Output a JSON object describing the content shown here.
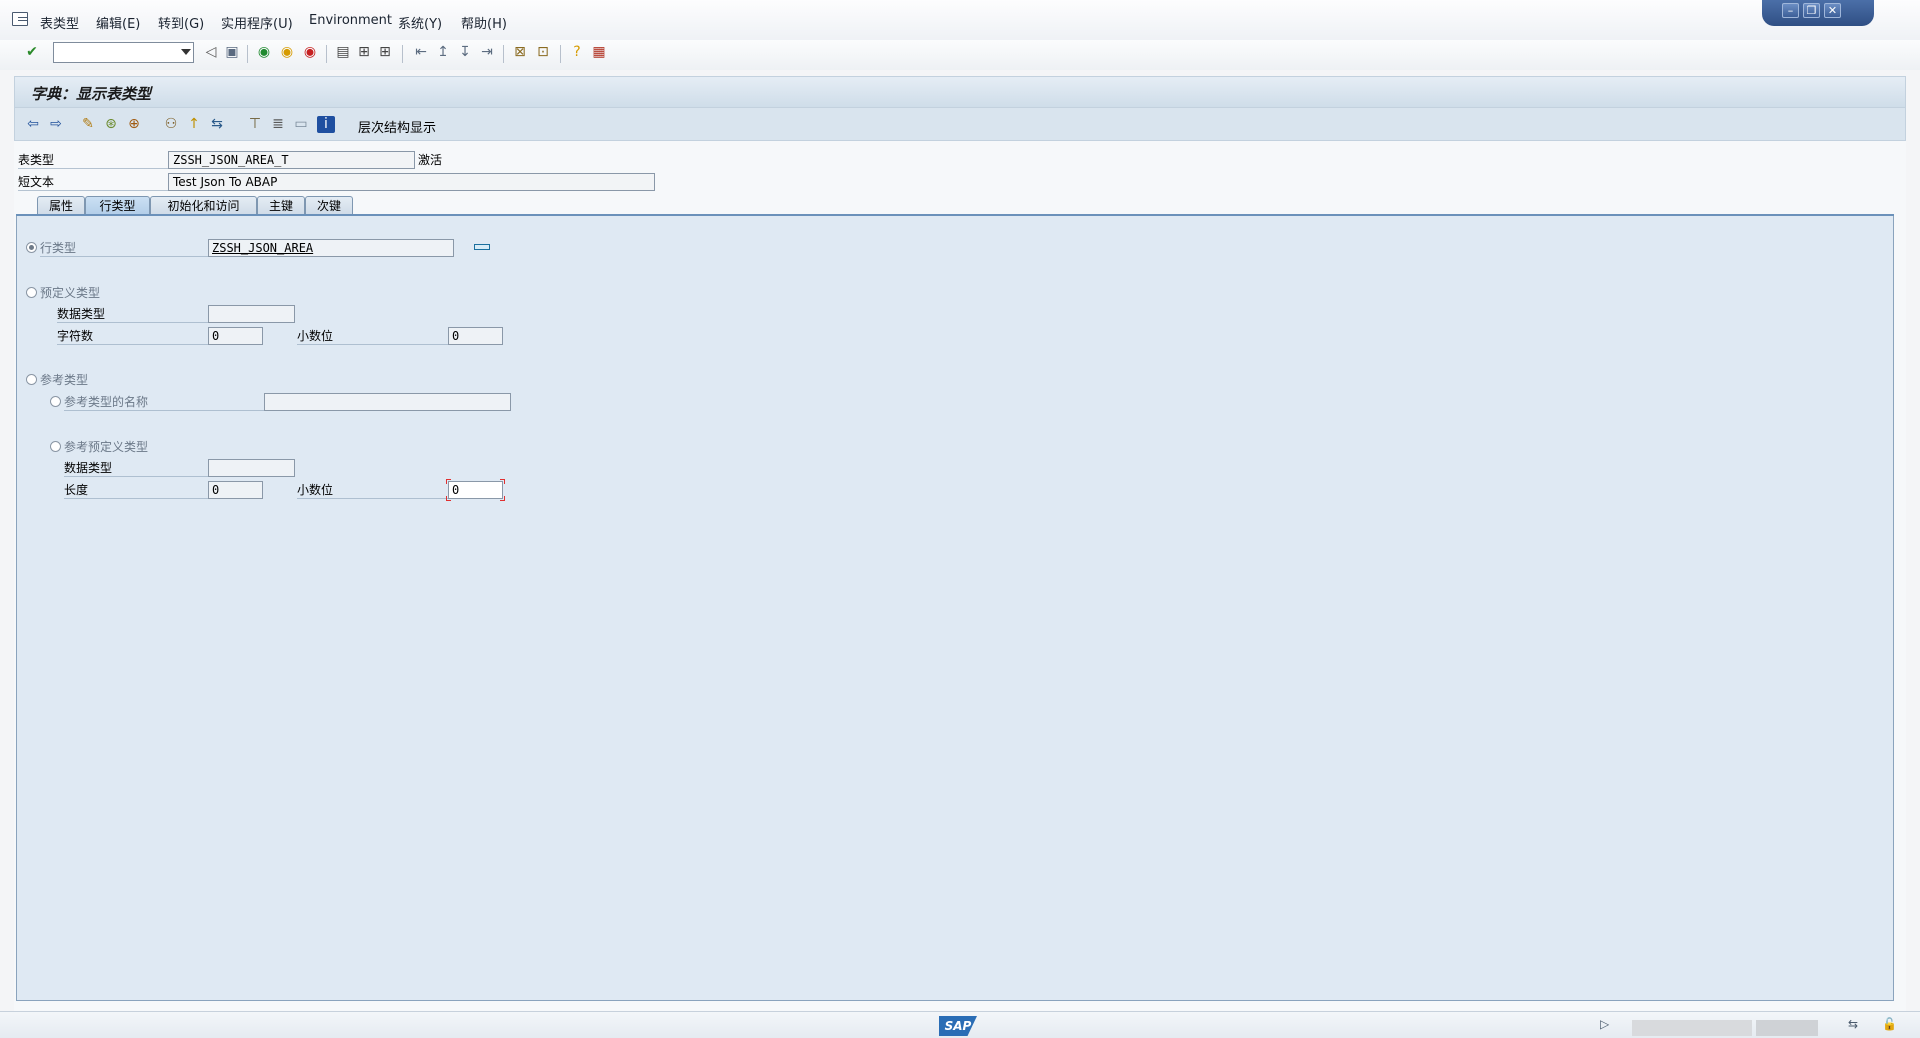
{
  "menu": {
    "items": [
      "表类型",
      "编辑(E)",
      "转到(G)",
      "实用程序(U)",
      "Environment",
      "系统(Y)",
      "帮助(H)"
    ]
  },
  "window_controls": {
    "minimize": "–",
    "restore": "❐",
    "close": "✕"
  },
  "toolbar": {
    "command_field_value": ""
  },
  "title": {
    "text": "字典：显示表类型"
  },
  "app_toolbar": {
    "hierarchy_label": "层次结构显示"
  },
  "header": {
    "table_type_label": "表类型",
    "table_type_value": "ZSSH_JSON_AREA_T",
    "status": "激活",
    "short_text_label": "短文本",
    "short_text_value": "Test Json To ABAP"
  },
  "tabs": [
    {
      "label": "属性",
      "active": false
    },
    {
      "label": "行类型",
      "active": true
    },
    {
      "label": "初始化和访问",
      "active": false
    },
    {
      "label": "主键",
      "active": false
    },
    {
      "label": "次键",
      "active": false
    }
  ],
  "row_type": {
    "label": "行类型",
    "value": "ZSSH_JSON_AREA",
    "selected": true
  },
  "predefined_type": {
    "label": "预定义类型",
    "data_type_label": "数据类型",
    "data_type_value": "",
    "char_count_label": "字符数",
    "char_count_value": "0",
    "decimals_label": "小数位",
    "decimals_value": "0"
  },
  "ref_type": {
    "label": "参考类型",
    "ref_name_label": "参考类型的名称",
    "ref_name_value": "",
    "ref_predef_label": "参考预定义类型",
    "data_type_label": "数据类型",
    "data_type_value": "",
    "length_label": "长度",
    "length_value": "0",
    "decimals_label": "小数位",
    "decimals_value": "0"
  },
  "status_bar": {
    "logo": "SAP"
  },
  "colors": {
    "panel_bg": "#dfe9f3",
    "title_bg": "#cfdde9",
    "tab_active": "#b2cde8",
    "focus_corner": "#e03030"
  }
}
